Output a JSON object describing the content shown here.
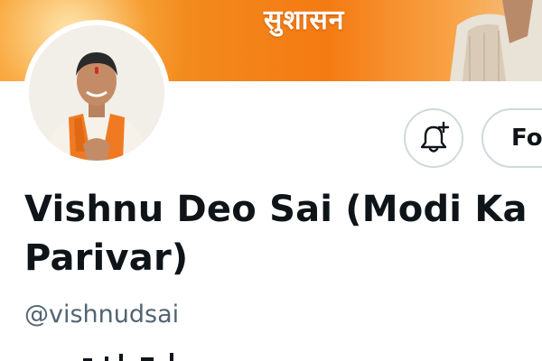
{
  "banner": {
    "slogan": "सुशासन",
    "colors": {
      "orange": "#f28a1e",
      "light": "#f8a64a"
    }
  },
  "profile": {
    "avatar_icon": "profile-photo",
    "display_name": "Vishnu Deo Sai (Modi Ka Parivar)",
    "handle": "@vishnudsai"
  },
  "actions": {
    "notify_icon": "bell-plus-icon",
    "follow_label": "Fo"
  },
  "colors": {
    "text_primary": "#0f1419",
    "text_secondary": "#536471",
    "border": "#cfd9de"
  }
}
